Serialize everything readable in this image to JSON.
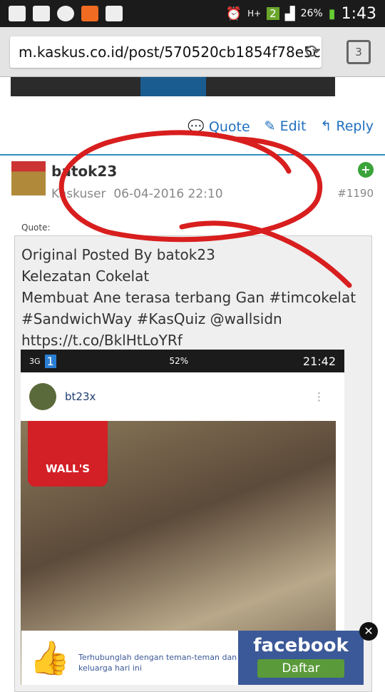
{
  "status_bar": {
    "battery": "26%",
    "network": "H+",
    "sim": "2",
    "time": "1:43",
    "icons": [
      "gallery-icon",
      "karaoke-icon",
      "line-icon",
      "lazada-icon",
      "bbm-icon",
      "alarm-icon",
      "signal-icon",
      "battery-icon"
    ]
  },
  "browser": {
    "url": "m.kaskus.co.id/post/570520cb1854f78e5c",
    "tab_count": "3"
  },
  "post_actions": {
    "quote": "Quote",
    "edit": "Edit",
    "reply": "Reply"
  },
  "post": {
    "username": "batok23",
    "rank": "Kaskuser",
    "datetime": "06-04-2016 22:10",
    "number": "#1190",
    "quote_label": "Quote:",
    "quote_lines": [
      "Original Posted By batok23",
      "Kelezatan Cokelat",
      "Membuat Ane terasa terbang Gan #timcokelat",
      "#SandwichWay #KasQuiz @wallsidn",
      "https://t.co/BklHtLoYRf"
    ]
  },
  "embedded_screenshot": {
    "battery": "52%",
    "network": "3G",
    "sim": "1",
    "time": "21:42",
    "ig_user": "bt23x",
    "brand": "WALL'S"
  },
  "ad": {
    "text": "Terhubunglah dengan teman-teman dan keluarga hari ini",
    "brand": "facebook",
    "button": "Daftar"
  },
  "colors": {
    "link": "#1f6fbf",
    "annotation": "#d81e1e",
    "facebook": "#3b5998"
  }
}
